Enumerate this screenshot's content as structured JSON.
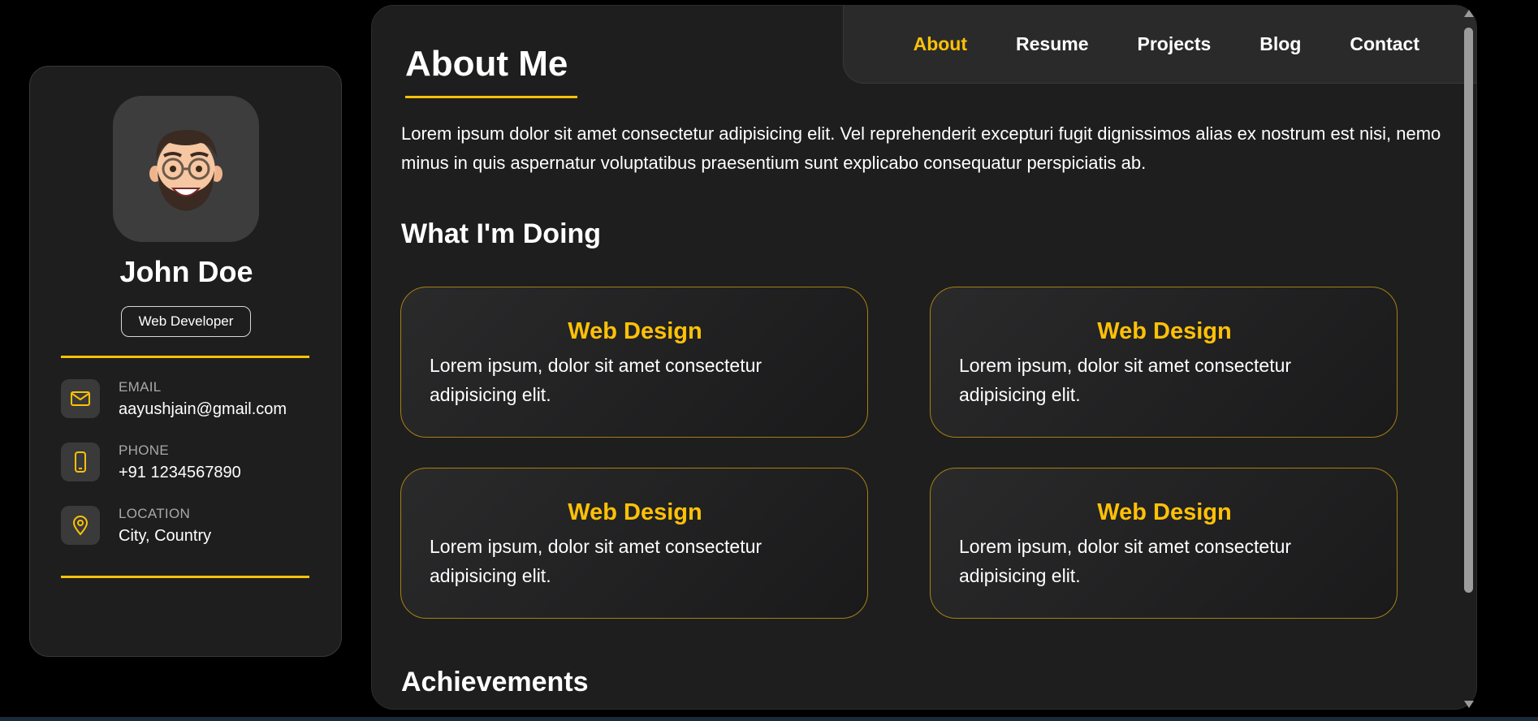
{
  "sidebar": {
    "name": "John Doe",
    "role": "Web Developer",
    "contacts": [
      {
        "label": "EMAIL",
        "value": "aayushjain@gmail.com",
        "icon": "mail-icon"
      },
      {
        "label": "PHONE",
        "value": "+91 1234567890",
        "icon": "phone-icon"
      },
      {
        "label": "LOCATION",
        "value": "City, Country",
        "icon": "location-icon"
      }
    ]
  },
  "nav": {
    "items": [
      {
        "label": "About",
        "active": true
      },
      {
        "label": "Resume",
        "active": false
      },
      {
        "label": "Projects",
        "active": false
      },
      {
        "label": "Blog",
        "active": false
      },
      {
        "label": "Contact",
        "active": false
      }
    ]
  },
  "main": {
    "title": "About Me",
    "about_text": "Lorem ipsum dolor sit amet consectetur adipisicing elit. Vel reprehenderit excepturi fugit dignissimos alias ex nostrum est nisi, nemo minus in quis aspernatur voluptatibus praesentium sunt explicabo consequatur perspiciatis ab.",
    "doing_title": "What I'm Doing",
    "services": [
      {
        "title": "Web Design",
        "text": "Lorem ipsum, dolor sit amet consectetur adipisicing elit."
      },
      {
        "title": "Web Design",
        "text": "Lorem ipsum, dolor sit amet consectetur adipisicing elit."
      },
      {
        "title": "Web Design",
        "text": "Lorem ipsum, dolor sit amet consectetur adipisicing elit."
      },
      {
        "title": "Web Design",
        "text": "Lorem ipsum, dolor sit amet consectetur adipisicing elit."
      }
    ],
    "achievements_title": "Achievements"
  },
  "colors": {
    "accent": "#ffc107",
    "background": "#000000",
    "panel": "#1e1e1f",
    "nav": "#2a2a2b"
  }
}
